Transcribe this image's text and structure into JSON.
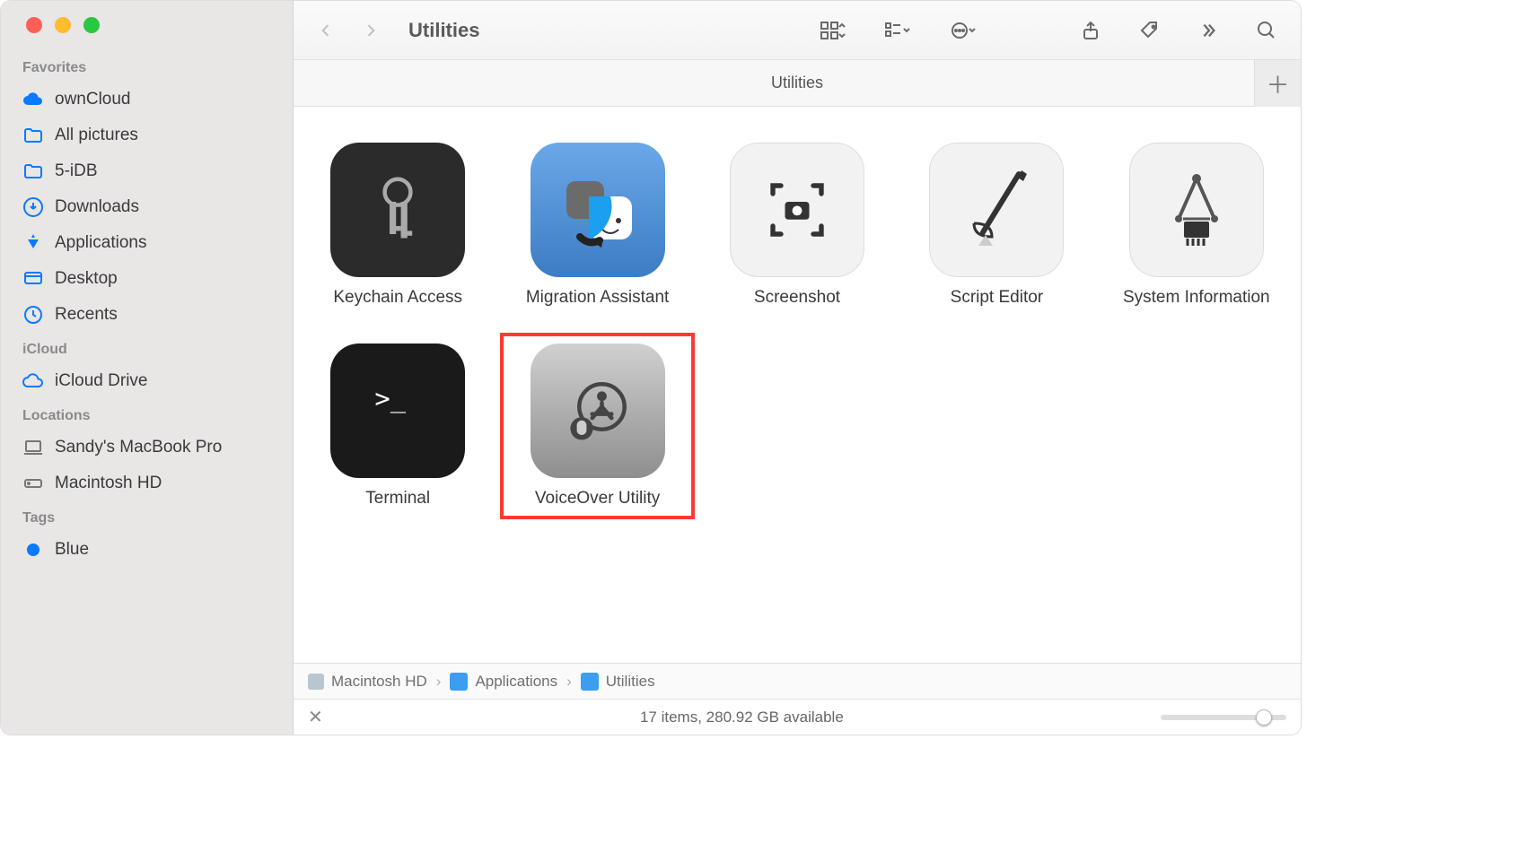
{
  "window": {
    "title": "Utilities"
  },
  "sidebar": {
    "sections": [
      {
        "title": "Favorites",
        "items": [
          {
            "label": "ownCloud",
            "icon": "cloud-sync-icon"
          },
          {
            "label": "All pictures",
            "icon": "folder-icon"
          },
          {
            "label": "5-iDB",
            "icon": "folder-icon"
          },
          {
            "label": "Downloads",
            "icon": "download-icon"
          },
          {
            "label": "Applications",
            "icon": "applications-icon"
          },
          {
            "label": "Desktop",
            "icon": "desktop-icon"
          },
          {
            "label": "Recents",
            "icon": "clock-icon"
          }
        ]
      },
      {
        "title": "iCloud",
        "items": [
          {
            "label": "iCloud Drive",
            "icon": "cloud-icon"
          }
        ]
      },
      {
        "title": "Locations",
        "items": [
          {
            "label": "Sandy's MacBook Pro",
            "icon": "laptop-icon",
            "gray": true
          },
          {
            "label": "Macintosh HD",
            "icon": "disk-icon",
            "gray": true
          }
        ]
      },
      {
        "title": "Tags",
        "items": [
          {
            "label": "Blue",
            "icon": "tag-dot",
            "color": "#0a7aff"
          }
        ]
      }
    ]
  },
  "tabbar": {
    "active_tab": "Utilities"
  },
  "pathbar": {
    "crumbs": [
      {
        "label": "Macintosh HD",
        "icon": "disk-mini-icon"
      },
      {
        "label": "Applications",
        "icon": "folder-mini-icon"
      },
      {
        "label": "Utilities",
        "icon": "folder-mini-icon"
      }
    ]
  },
  "statusbar": {
    "text": "17 items, 280.92 GB available"
  },
  "apps": [
    {
      "label": "Keychain Access",
      "icon": "keychain-icon",
      "cls": "ic-keychain"
    },
    {
      "label": "Migration Assistant",
      "icon": "migration-icon",
      "cls": "ic-migration"
    },
    {
      "label": "Screenshot",
      "icon": "screenshot-icon",
      "cls": "ic-screenshot"
    },
    {
      "label": "Script Editor",
      "icon": "script-icon",
      "cls": "ic-script"
    },
    {
      "label": "System Information",
      "icon": "sysinfo-icon",
      "cls": "ic-sysinfo"
    },
    {
      "label": "Terminal",
      "icon": "terminal-icon",
      "cls": "ic-terminal"
    },
    {
      "label": "VoiceOver Utility",
      "icon": "voiceover-icon",
      "cls": "ic-voiceover",
      "highlight": true
    }
  ]
}
